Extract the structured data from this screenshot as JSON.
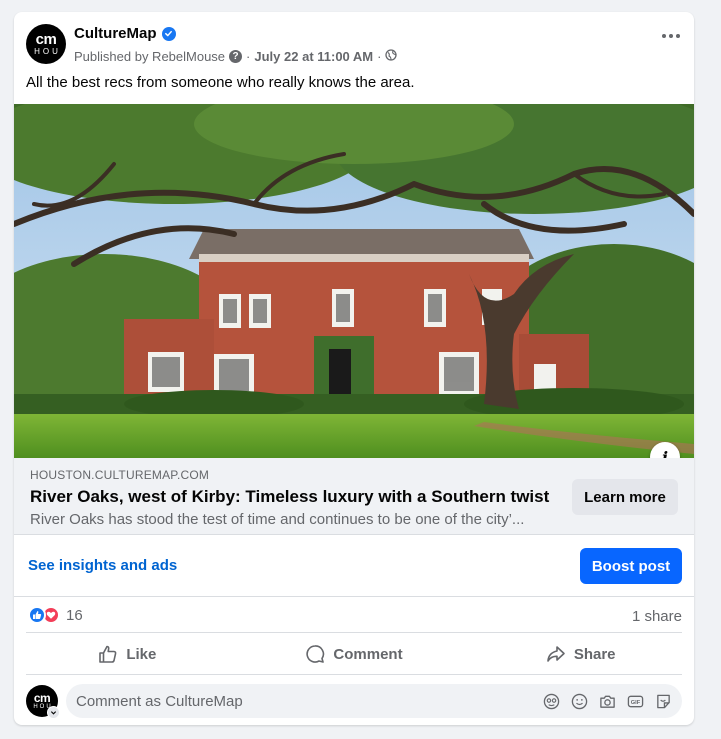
{
  "post": {
    "page_name": "CultureMap",
    "avatar_primary": "cm",
    "avatar_secondary": "HOU",
    "published_by": "Published by RebelMouse",
    "date": "July 22 at 11:00 AM",
    "separator": "·",
    "text": "All the best recs from someone who really knows the area.",
    "verified_icon": "verified-badge-icon",
    "audience_icon": "globe-icon"
  },
  "link_preview": {
    "domain": "HOUSTON.CULTUREMAP.COM",
    "headline": "River Oaks, west of Kirby: Timeless luxury with a Southern twist",
    "description": "River Oaks has stood the test of time and continues to be one of the city’...",
    "cta_label": "Learn more",
    "info_icon": "i"
  },
  "insights": {
    "link_label": "See insights and ads",
    "boost_label": "Boost post"
  },
  "engagement": {
    "reaction_count": "16",
    "shares": "1 share"
  },
  "actions": {
    "like": "Like",
    "comment": "Comment",
    "share": "Share"
  },
  "comment": {
    "placeholder": "Comment as CultureMap"
  },
  "colors": {
    "brand_blue": "#0866ff",
    "link_blue": "#0064d1",
    "love_red": "#f33e58",
    "secondary_text": "#65676b"
  }
}
